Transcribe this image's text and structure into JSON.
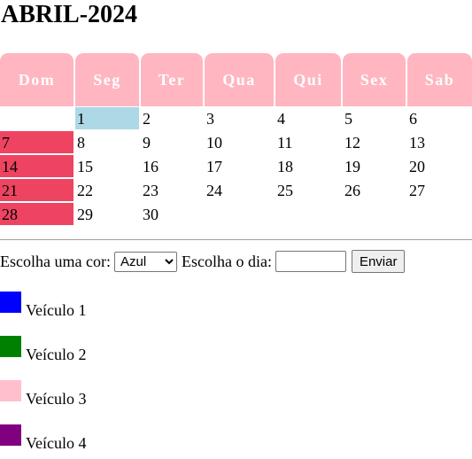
{
  "title": "ABRIL-2024",
  "weekdays": [
    "Dom",
    "Seg",
    "Ter",
    "Qua",
    "Qui",
    "Sex",
    "Sab"
  ],
  "weeks": [
    [
      "",
      "1",
      "2",
      "3",
      "4",
      "5",
      "6"
    ],
    [
      "7",
      "8",
      "9",
      "10",
      "11",
      "12",
      "13"
    ],
    [
      "14",
      "15",
      "16",
      "17",
      "18",
      "19",
      "20"
    ],
    [
      "21",
      "22",
      "23",
      "24",
      "25",
      "26",
      "27"
    ],
    [
      "28",
      "29",
      "30",
      "",
      "",
      "",
      ""
    ]
  ],
  "selected_day": "1",
  "colors": {
    "header_bg": "#ffb6c1",
    "sunday_bg": "#ee4461",
    "selected_bg": "#add8e6"
  },
  "controls": {
    "color_label": "Escolha uma cor:",
    "color_value": "Azul",
    "day_label": "Escolha o dia:",
    "day_value": "",
    "send_label": "Enviar"
  },
  "vehicles": [
    {
      "label": "Veículo 1",
      "color": "#0000ff"
    },
    {
      "label": "Veículo 2",
      "color": "#008000"
    },
    {
      "label": "Veículo 3",
      "color": "#ffc0cb"
    },
    {
      "label": "Veículo 4",
      "color": "#800080"
    }
  ]
}
